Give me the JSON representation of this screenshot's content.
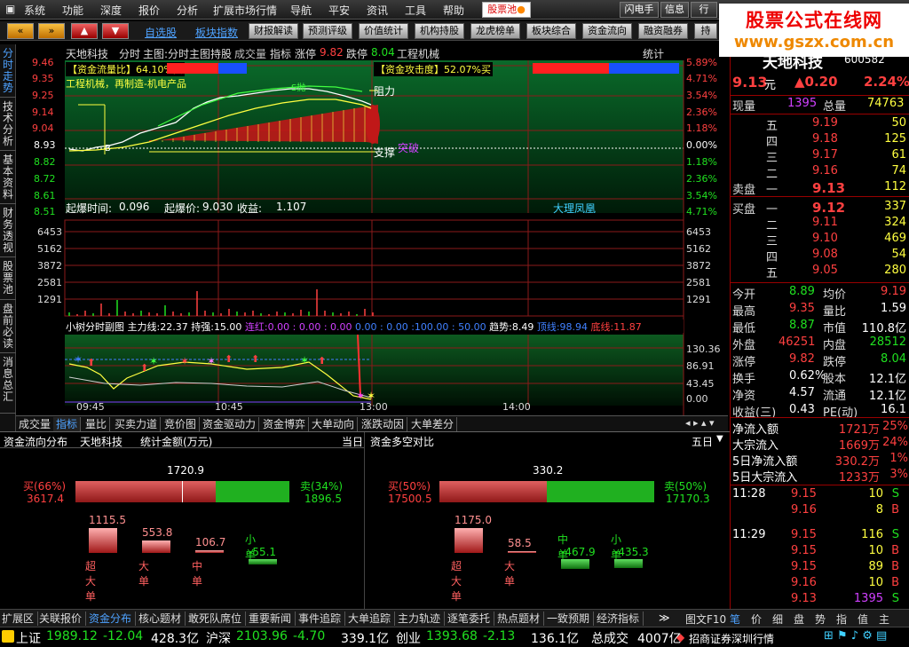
{
  "menu": {
    "items": [
      "系统",
      "功能",
      "深度",
      "报价",
      "分析",
      "扩展市场行情",
      "导航",
      "平安",
      "资讯",
      "工具",
      "帮助"
    ],
    "pool": "股票池",
    "right_items": [
      "闪电手",
      "信息",
      "行"
    ]
  },
  "watermark": {
    "line1": "股票公式在线网",
    "line2": "www.gszx.com.cn"
  },
  "toolbar": {
    "links": [
      "自选股",
      "板块指数"
    ],
    "buttons": [
      "财报解读",
      "预测评级",
      "价值统计",
      "机构持股",
      "龙虎榜单",
      "板块综合",
      "资金流向",
      "融资融券",
      "持"
    ]
  },
  "left_tabs": [
    "分时走势",
    "技术分析",
    "基本资料",
    "财务透视",
    "股票池",
    "盘前必读",
    "消息总汇"
  ],
  "chart": {
    "header": {
      "name": "天地科技",
      "items": [
        "分时",
        "主图:分时主图持股"
      ],
      "vol": "成交量",
      "ind": "指标",
      "zt_label": "涨停",
      "zt": "9.82",
      "dt_label": "跌停",
      "dt": "8.04",
      "sector": "工程机械",
      "stat": "统计"
    },
    "price_ticks": [
      "9.46",
      "9.35",
      "9.25",
      "9.14",
      "9.04",
      "8.93",
      "8.82",
      "8.72",
      "8.61",
      "8.51"
    ],
    "pct_ticks": [
      "5.89%",
      "4.71%",
      "3.54%",
      "2.36%",
      "1.18%",
      "0.00%",
      "1.18%",
      "2.36%",
      "3.54%",
      "4.71%"
    ],
    "flow_label": "【资金流量比】64.10%买",
    "attack_label": "【资金攻击度】52.07%买",
    "industry": "工程机械，再制造-机电产品",
    "resist": "阻力",
    "support": "支撑",
    "breakout": "突破",
    "mark_b": "B",
    "mark_s": "S抛",
    "bomb": {
      "time_label": "起爆时间:",
      "time": "0.096",
      "price_label": "起爆价:",
      "price": "9.030",
      "gain_label": "收益:",
      "gain": "1.107",
      "tag": "大理凤凰"
    },
    "vol_ticks": [
      "6453",
      "5162",
      "3872",
      "2581",
      "1291"
    ],
    "sub": {
      "name": "小树分时副图",
      "main_label": "主力线:",
      "main": "22.37",
      "hold_label": "持强:",
      "hold": "15.00",
      "lian_label": "连红:",
      "zeros": "0.00 : 0.00 : 0.00",
      "zeros2": "0.00 : 0.00 :100.00 : 50.00",
      "trend_label": "趋势:",
      "trend": "8.49",
      "top_label": "顶线:",
      "top": "98.94",
      "bottom_label": "底线:",
      "bottom": "11.87"
    },
    "sub_ticks": [
      "130.36",
      "86.91",
      "43.45",
      "0.00"
    ],
    "time_ticks": [
      "09:45",
      "10:45",
      "13:00",
      "14:00"
    ]
  },
  "bottom_tabs": [
    "成交量",
    "指标",
    "量比",
    "买卖力道",
    "竞价图",
    "资金驱动力",
    "资金博弈",
    "大单动向",
    "涨跌动因",
    "大单差分"
  ],
  "quote": {
    "name": "天地科技",
    "code": "600582",
    "price": "9.13",
    "price_unit": "元",
    "chg": "▲0.20",
    "pct": "2.24%",
    "xianliang_label": "现量",
    "xianliang": "1395",
    "zongliang_label": "总量",
    "zongliang": "74763",
    "sells": [
      {
        "l": "五",
        "p": "9.19",
        "v": "50"
      },
      {
        "l": "四",
        "p": "9.18",
        "v": "125"
      },
      {
        "l": "三",
        "p": "9.17",
        "v": "61"
      },
      {
        "l": "二",
        "p": "9.16",
        "v": "74"
      },
      {
        "l": "一",
        "p": "9.13",
        "v": "112"
      }
    ],
    "sell_label": "卖盘",
    "buy_label": "买盘",
    "buys": [
      {
        "l": "一",
        "p": "9.12",
        "v": "337"
      },
      {
        "l": "二",
        "p": "9.11",
        "v": "324"
      },
      {
        "l": "三",
        "p": "9.10",
        "v": "469"
      },
      {
        "l": "四",
        "p": "9.08",
        "v": "54"
      },
      {
        "l": "五",
        "p": "9.05",
        "v": "280"
      }
    ],
    "stats": [
      [
        "今开",
        "8.89",
        "均价",
        "9.19"
      ],
      [
        "最高",
        "9.35",
        "量比",
        "1.59"
      ],
      [
        "最低",
        "8.87",
        "市值",
        "110.8亿"
      ],
      [
        "外盘",
        "46251",
        "内盘",
        "28512"
      ],
      [
        "涨停",
        "9.82",
        "跌停",
        "8.04"
      ],
      [
        "换手",
        "0.62%",
        "股本",
        "12.1亿"
      ],
      [
        "净资",
        "4.57",
        "流通",
        "12.1亿"
      ],
      [
        "收益(三)",
        "0.43",
        "PE(动)",
        "16.1"
      ]
    ],
    "flows": [
      [
        "净流入额",
        "1721万",
        "25%"
      ],
      [
        "大宗流入",
        "1669万",
        "24%"
      ],
      [
        "5日净流入额",
        "330.2万",
        "1%"
      ],
      [
        "5日大宗流入",
        "1233万",
        "3%"
      ]
    ],
    "ticks": [
      [
        "11:28",
        "9.15",
        "10",
        "S"
      ],
      [
        "",
        "9.16",
        "8",
        "B"
      ],
      [
        "11:29",
        "9.15",
        "116",
        "S"
      ],
      [
        "",
        "9.15",
        "10",
        "B"
      ],
      [
        "",
        "9.15",
        "89",
        "B"
      ],
      [
        "",
        "9.16",
        "10",
        "B"
      ],
      [
        "",
        "9.13",
        "1395",
        "S"
      ]
    ]
  },
  "flow_panel": {
    "left_title": "资金流向分布",
    "left_name": "天地科技",
    "left_sub": "统计金额(万元)",
    "left_period": "当日",
    "right_title": "资金多空对比",
    "right_period": "五日",
    "left_total": "1720.9",
    "left_buy_pct": "买(66%)",
    "left_buy": "3617.4",
    "left_sell_pct": "卖(34%)",
    "left_sell": "1896.5",
    "left_bars": [
      {
        "v": "1115.5",
        "n": "超大单"
      },
      {
        "v": "553.8",
        "n": "大单"
      },
      {
        "v": "106.7",
        "n": "中单"
      },
      {
        "v": "-55.1",
        "n": "小单"
      }
    ],
    "right_total": "330.2",
    "right_buy_pct": "买(50%)",
    "right_buy": "17500.5",
    "right_sell_pct": "卖(50%)",
    "right_sell": "17170.3",
    "right_bars": [
      {
        "v": "1175.0",
        "n": "超大单"
      },
      {
        "v": "58.5",
        "n": "大单"
      },
      {
        "v": "-467.9",
        "n": "中单"
      },
      {
        "v": "-435.3",
        "n": "小单"
      }
    ]
  },
  "footer_tabs": [
    "扩展区",
    "关联报价",
    "资金分布",
    "核心题材",
    "敢死队席位",
    "重要新闻",
    "事件追踪",
    "大单追踪",
    "主力轨迹",
    "逐笔委托",
    "热点题材",
    "一致预期",
    "经济指标"
  ],
  "footer_right": [
    "图文F10",
    "笔",
    "价",
    "细",
    "盘",
    "势",
    "指",
    "值",
    "主"
  ],
  "index_bar": [
    {
      "name": "上证",
      "val": "1989.12",
      "chg": "-12.04",
      "amt": "428.3亿"
    },
    {
      "name": "沪深",
      "val": "2103.96",
      "chg": "-4.70",
      "amt": "339.1亿"
    },
    {
      "name": "创业",
      "val": "1393.68",
      "chg": "-2.13",
      "amt": "136.1亿"
    }
  ],
  "total_label": "总成交",
  "total": "4007亿",
  "broker": "招商证券深圳行情"
}
